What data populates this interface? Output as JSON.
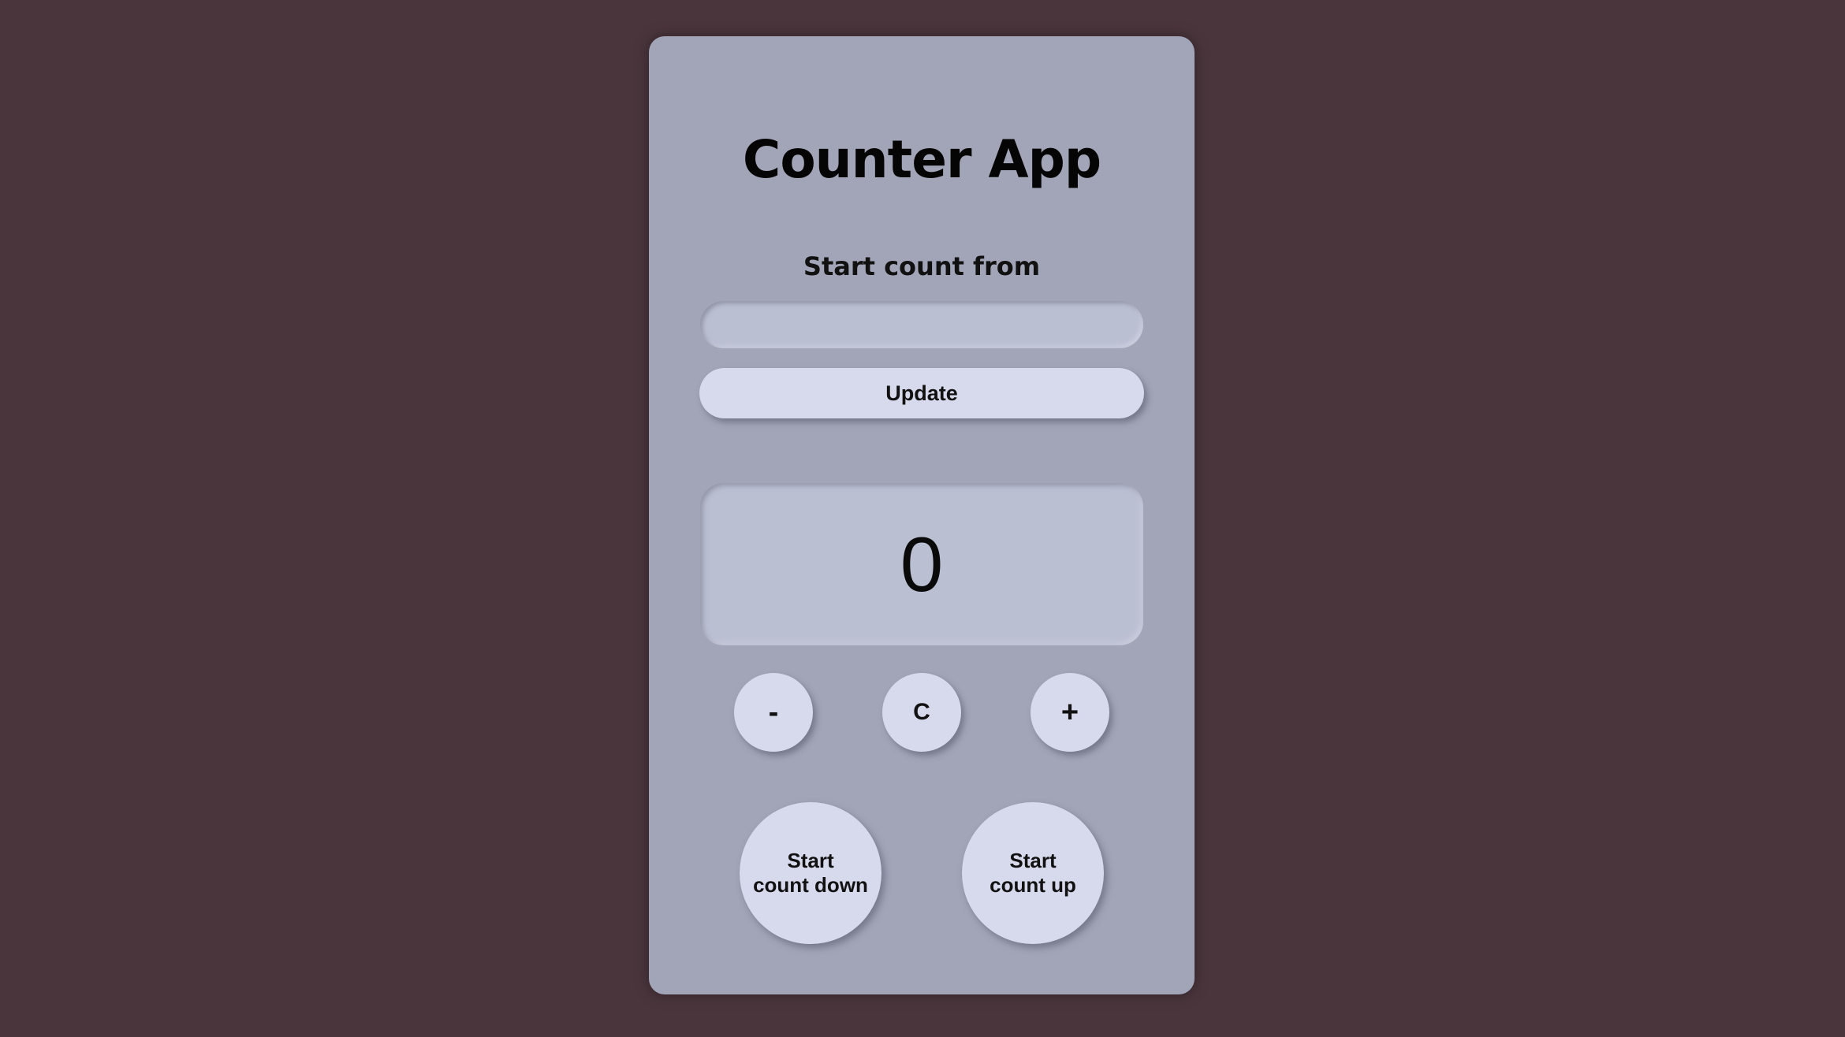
{
  "app": {
    "title": "Counter App"
  },
  "start_form": {
    "label": "Start count from",
    "input_value": "",
    "input_placeholder": "",
    "update_label": "Update"
  },
  "counter": {
    "value": "0"
  },
  "controls": {
    "decrement_label": "-",
    "clear_label": "C",
    "increment_label": "+"
  },
  "auto": {
    "count_down_label": "Start\ncount down",
    "count_up_label": "Start\ncount up"
  },
  "colors": {
    "page_background": "#4a353c",
    "card_background": "#a1a5b7",
    "button_background": "#d7daec",
    "inset_background": "#bbbfd2"
  }
}
